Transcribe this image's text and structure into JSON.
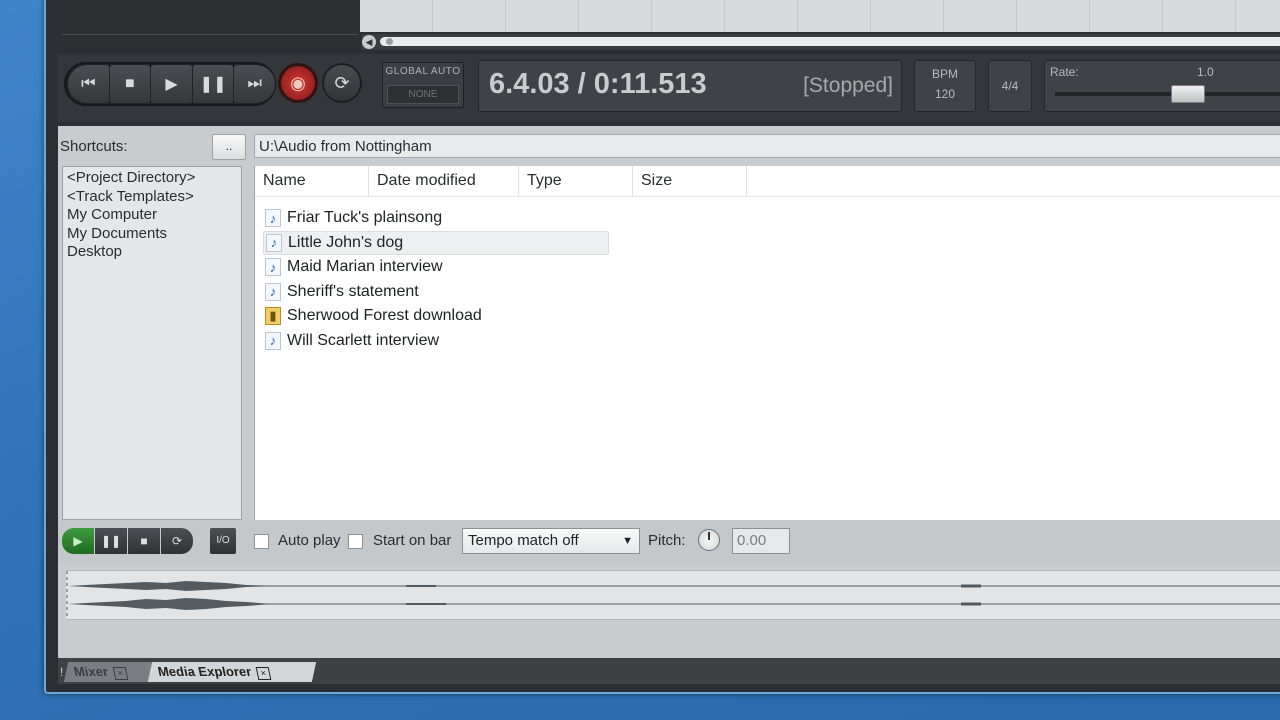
{
  "transport": {
    "global_auto_label": "GLOBAL AUTO",
    "global_auto_value": "NONE",
    "position": "6.4.03 / 0:11.513",
    "state": "[Stopped]",
    "bpm_label": "BPM",
    "bpm_value": "120",
    "time_signature": "4/4",
    "rate_label": "Rate:",
    "rate_value": "1.0",
    "icons": [
      "skip-back-icon",
      "stop-icon",
      "play-icon",
      "pause-icon",
      "skip-forward-icon",
      "record-icon",
      "repeat-icon"
    ]
  },
  "media_explorer": {
    "shortcuts_label": "Shortcuts:",
    "browse_button": "..",
    "path": "U:\\Audio from Nottingham",
    "shortcuts": [
      "<Project Directory>",
      "<Track Templates>",
      "My Computer",
      "My Documents",
      "Desktop"
    ],
    "columns": [
      "Name",
      "Date modified",
      "Type",
      "Size"
    ],
    "files": [
      {
        "name": "Friar Tuck's plainsong",
        "icon": "audio-file-icon"
      },
      {
        "name": "Little John's dog",
        "icon": "audio-file-icon",
        "selected": true
      },
      {
        "name": "Maid Marian interview",
        "icon": "audio-file-icon"
      },
      {
        "name": "Sheriff's statement",
        "icon": "audio-file-icon"
      },
      {
        "name": "Sherwood Forest download",
        "icon": "zip-folder-icon"
      },
      {
        "name": "Will Scarlett interview",
        "icon": "audio-file-icon"
      }
    ],
    "preview": {
      "io_label": "I/O",
      "auto_play_label": "Auto play",
      "start_on_bar_label": "Start on bar",
      "tempo_match_value": "Tempo match off",
      "pitch_label": "Pitch:",
      "pitch_value": "0.00"
    }
  },
  "tabs": {
    "mixer": "Mixer",
    "media_explorer": "Media Explorer"
  }
}
